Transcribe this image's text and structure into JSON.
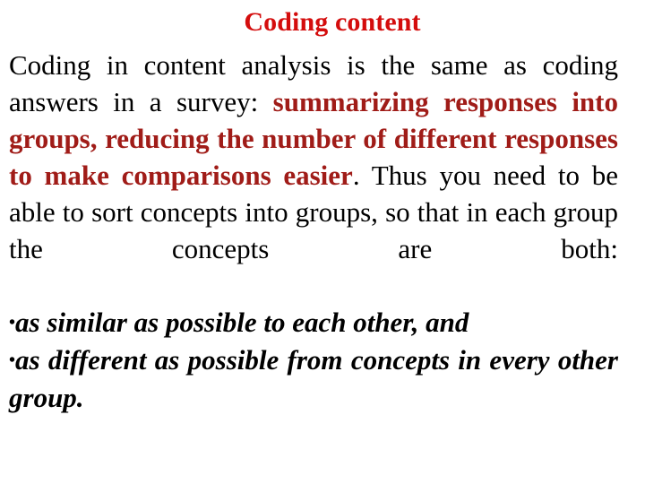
{
  "slide": {
    "background_color": "#ffffff",
    "title": {
      "text": "Coding content",
      "color": "#d40d0d"
    },
    "body": {
      "paragraph": {
        "segments": [
          {
            "text": "Coding in content analysis is the same as coding answers in a survey: ",
            "style": "plain",
            "color": "#000000"
          },
          {
            "text": "summarizing responses into groups, reducing the number of different responses to make comparisons easier",
            "style": "bold",
            "color": "#a01c18"
          },
          {
            "text": ". Thus you need to be able to sort concepts into groups, so that in each group the concepts are both:",
            "style": "plain",
            "color": "#000000"
          }
        ],
        "full_text": "Coding in content analysis is the same as coding answers in a survey: summarizing responses into groups, reducing the number of different responses to make comparisons easier. Thus you need to be able to sort concepts into groups, so that in each group the concepts are both:"
      },
      "bullets": [
        {
          "glyph": "•",
          "text": "as similar as possible to each other, and",
          "style": "bold-italic",
          "color": "#000000"
        },
        {
          "glyph": "•",
          "text": "as different as possible from concepts in every other group.",
          "style": "bold-italic",
          "color": "#000000"
        }
      ]
    }
  }
}
